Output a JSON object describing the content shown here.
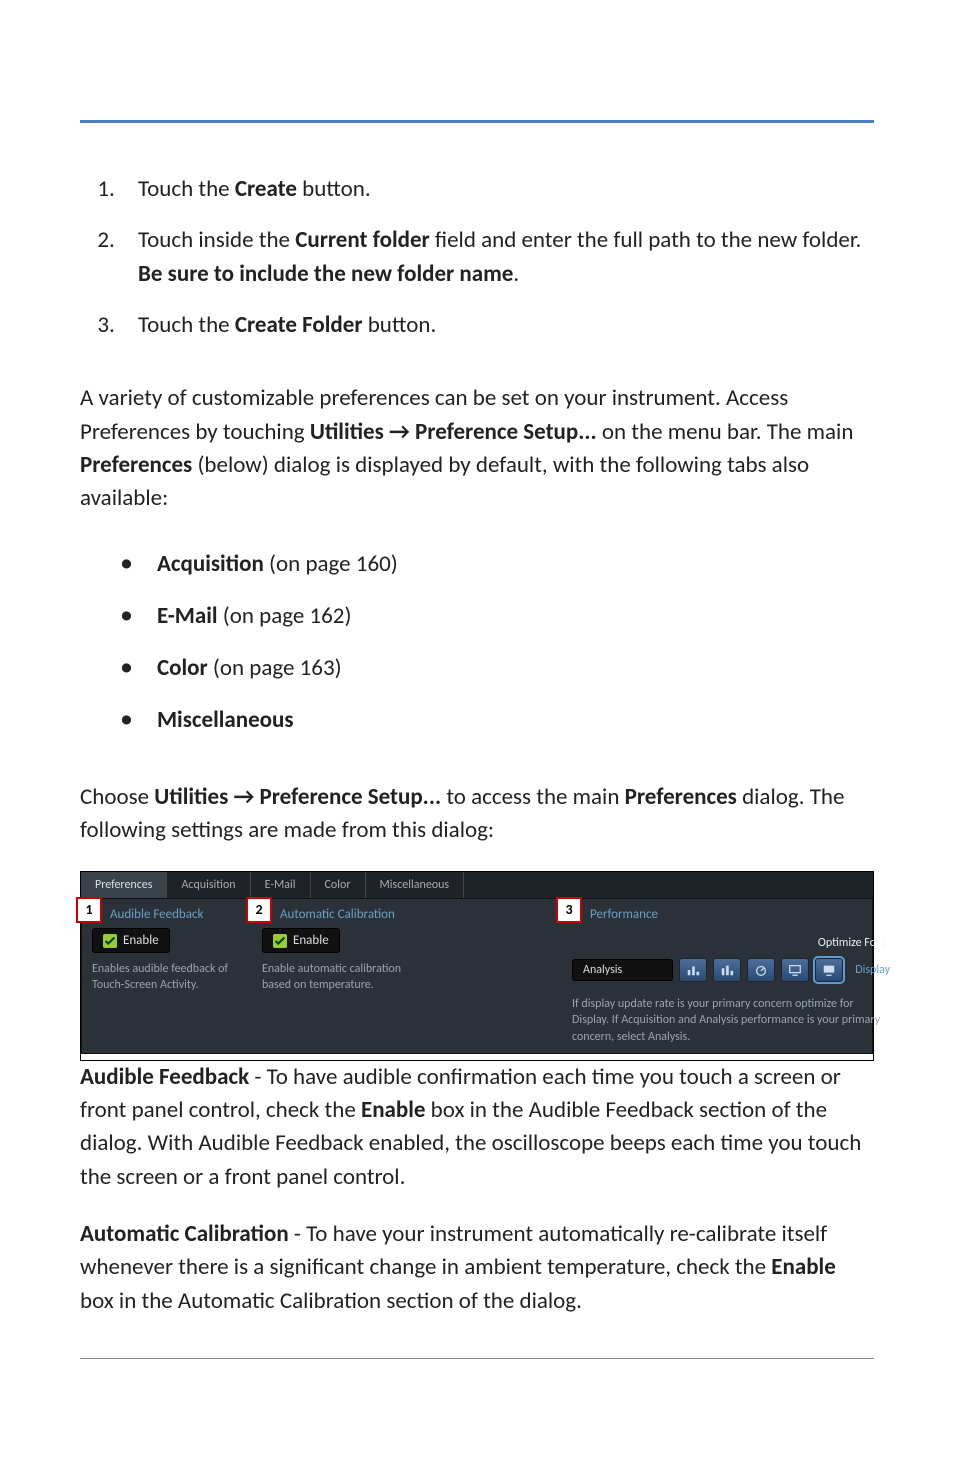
{
  "steps": [
    {
      "pre": "Touch the ",
      "bold": "Create",
      "post": " button."
    },
    {
      "pre": "Touch inside the ",
      "bold": "Current folder",
      "mid": " field and enter the full path to the new folder. ",
      "bold2": "Be sure to include the new folder name",
      "post": "."
    },
    {
      "pre": "Touch the ",
      "bold": "Create Folder",
      "post": " button."
    }
  ],
  "intro": {
    "t1": "A variety of customizable preferences can be set on your instrument. Access Preferences by touching ",
    "b1": "Utilities → Preference Setup...",
    "t2": " on the menu bar. The main ",
    "b2": "Preferences",
    "t3": " (below) dialog is displayed by default, with the following tabs also available:"
  },
  "tabsList": [
    {
      "b": "Acquisition",
      "rest": " (on page 160)"
    },
    {
      "b": "E-Mail",
      "rest": " (on page 162)"
    },
    {
      "b": "Color",
      "rest": " (on page 163)"
    },
    {
      "b": "Miscellaneous",
      "rest": ""
    }
  ],
  "choose": {
    "t1": "Choose  ",
    "b1": "Utilities → Preference Setup...",
    "t2": " to access the main ",
    "b2": "Preferences",
    "t3": " dialog. The following settings are made from this dialog:"
  },
  "screenshot": {
    "tabs": [
      "Preferences",
      "Acquisition",
      "E-Mail",
      "Color",
      "Miscellaneous"
    ],
    "activeTab": 0,
    "callouts": [
      "1",
      "2",
      "3"
    ],
    "col1": {
      "heading": "Audible Feedback",
      "enable": "Enable",
      "desc": "Enables audible feedback of Touch-Screen Activity."
    },
    "col2": {
      "heading": "Automatic Calibration",
      "enable": "Enable",
      "desc": "Enable automatic calibration based on temperature."
    },
    "col3": {
      "heading": "Performance",
      "optimize": "Optimize For :",
      "analysis": "Analysis",
      "display": "Display",
      "note": "If display update rate is your primary concern optimize for Display. If Acquisition and Analysis performance is your primary concern, select Analysis."
    }
  },
  "audible": {
    "b1": "Audible Feedback",
    "t1": " - To have audible confirmation each time you touch a screen or front panel control, check the ",
    "b2": "Enable",
    "t2": " box in the Audible Feedback section of the dialog. With Audible Feedback enabled, the oscilloscope beeps each time you touch the screen or a front panel control."
  },
  "autocal": {
    "b1": "Automatic Calibration",
    "t1": " - To have your instrument automatically re-calibrate itself whenever there is a significant change in ambient temperature, check the ",
    "b2": "Enable",
    "t2": " box in the Automatic Calibration section of the dialog."
  }
}
